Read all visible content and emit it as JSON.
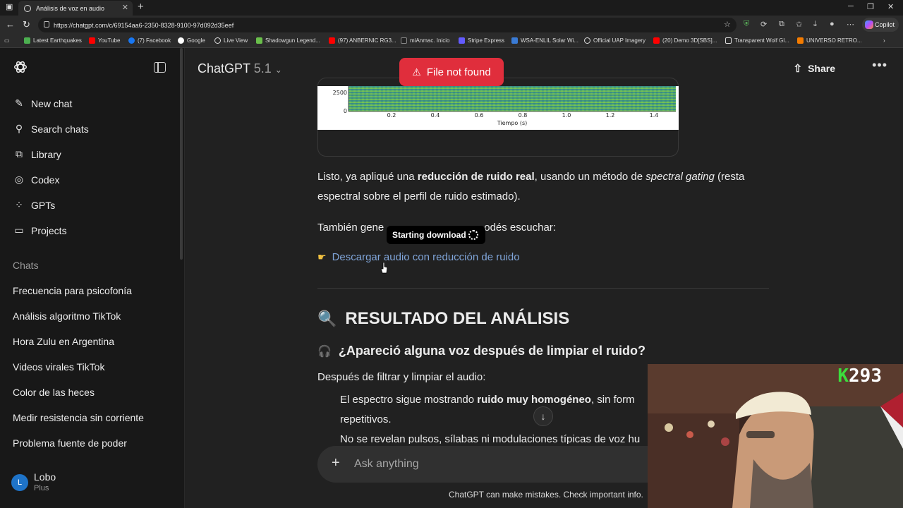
{
  "browser": {
    "tab_title": "Análisis de voz en audio",
    "url": "https://chatgpt.com/c/69154aa6-2350-8328-9100-97d092d35eef",
    "copilot_label": "Copilot",
    "bookmarks": [
      {
        "label": "Latest Earthquakes",
        "color": "#4caf50"
      },
      {
        "label": "YouTube",
        "color": "#ff0000"
      },
      {
        "label": "(7) Facebook",
        "color": "#1877f2"
      },
      {
        "label": "Google",
        "color": "#ffffff"
      },
      {
        "label": "Live View",
        "color": "#dddddd"
      },
      {
        "label": "Shadowgun Legend...",
        "color": "#6abf4b"
      },
      {
        "label": "(97) ANBERNIC RG3...",
        "color": "#ff0000"
      },
      {
        "label": "miAnmac. Inicio",
        "color": "#222222"
      },
      {
        "label": "Stripe Express",
        "color": "#635bff"
      },
      {
        "label": "WSA-ENLIL Solar Wi...",
        "color": "#3a7bd5"
      },
      {
        "label": "Official UAP Imagery",
        "color": "#dddddd"
      },
      {
        "label": "(20) Demo 3D[SBS]...",
        "color": "#ff0000"
      },
      {
        "label": "Transparent Wolf Gl...",
        "color": "#dddddd"
      },
      {
        "label": "UNIVERSO RETRO...",
        "color": "#f57c00"
      }
    ]
  },
  "sidebar": {
    "nav": [
      {
        "label": "New chat",
        "icon": "edit-icon"
      },
      {
        "label": "Search chats",
        "icon": "search-icon"
      },
      {
        "label": "Library",
        "icon": "library-icon"
      },
      {
        "label": "Codex",
        "icon": "codex-icon"
      },
      {
        "label": "GPTs",
        "icon": "gpts-icon"
      },
      {
        "label": "Projects",
        "icon": "folder-icon"
      }
    ],
    "section_label": "Chats",
    "chats": [
      "Frecuencia para psicofonía",
      "Análisis algoritmo TikTok",
      "Hora Zulu en Argentina",
      "Videos virales TikTok",
      "Color de las heces",
      "Medir resistencia sin corriente",
      "Problema fuente de poder"
    ],
    "user": {
      "initial": "L",
      "name": "Lobo",
      "plan": "Plus"
    }
  },
  "header": {
    "model_name": "ChatGPT",
    "model_version": "5.1",
    "share_label": "Share"
  },
  "toast": {
    "message": "File not found",
    "color": "#e02e3c"
  },
  "spectrogram": {
    "y_ticks": [
      "2500",
      "0"
    ],
    "x_ticks": [
      "0.2",
      "0.4",
      "0.6",
      "0.8",
      "1.0",
      "1.2",
      "1.4"
    ],
    "xlabel": "Tiempo (s)"
  },
  "message": {
    "p1_a": "Listo, ya apliqué una ",
    "p1_b": "reducción de ruido real",
    "p1_c": ", usando un método de ",
    "p1_d": "spectral gating",
    "p1_e": " (resta espectral sobre el perfil de ruido estimado).",
    "p2": "También gene",
    "p2_end": "odés escuchar:",
    "tooltip": "Starting download",
    "download_link": "Descargar audio con reducción de ruido",
    "heading": "RESULTADO DEL ANÁLISIS",
    "subheading": "¿Apareció alguna voz después de limpiar el ruido?",
    "p3": "Después de filtrar y limpiar el audio:",
    "bullet1_a": "El espectro sigue mostrando ",
    "bullet1_b": "ruido muy homogéneo",
    "bullet1_c": ", sin form",
    "bullet1_cont": "repetitivos.",
    "bullet2": "No se revelan pulsos, sílabas ni modulaciones típicas de voz hu"
  },
  "composer": {
    "placeholder": "Ask anything"
  },
  "footer": {
    "disclaimer": "ChatGPT can make mistakes. Check important info."
  },
  "overlay": {
    "kick_count": "293",
    "kick_letter": "K"
  }
}
